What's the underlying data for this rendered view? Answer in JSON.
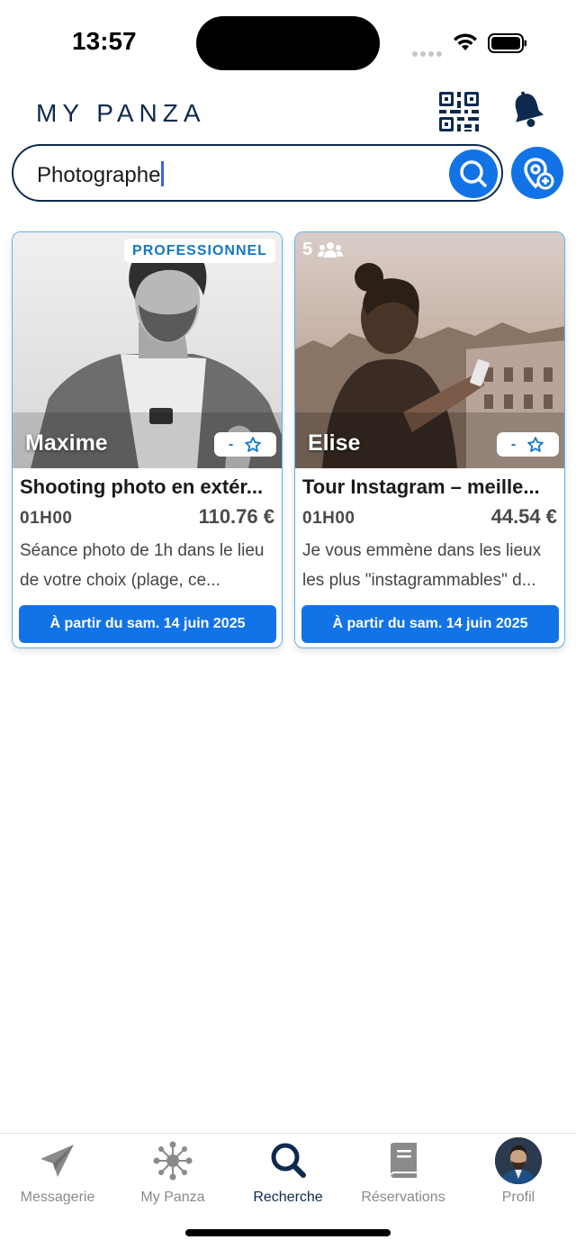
{
  "status": {
    "time": "13:57"
  },
  "header": {
    "brand": "MY PANZA",
    "qr_icon": "qr-code-icon",
    "bell_icon": "bell-icon"
  },
  "search": {
    "value": "Photographe",
    "search_icon": "search-icon",
    "location_icon": "location-add-icon"
  },
  "colors": {
    "primary": "#1273e6",
    "navy": "#0d2a4e",
    "card_border": "#5cb5ec",
    "badge_text": "#1578c2"
  },
  "cards": [
    {
      "badge": "PROFESSIONNEL",
      "host": "Maxime",
      "rating": "-",
      "title": "Shooting photo en extér...",
      "duration": "01H00",
      "price": "110.76 €",
      "description": "Séance photo de 1h dans le lieu de votre choix (plage, ce...",
      "date_button": "À partir du sam. 14 juin 2025"
    },
    {
      "group_count": "5",
      "host": "Elise",
      "rating": "-",
      "title": "Tour Instagram – meille...",
      "duration": "01H00",
      "price": "44.54 €",
      "description": "Je vous emmène dans les lieux les plus \"instagrammables\" d...",
      "date_button": "À partir du sam. 14 juin 2025"
    }
  ],
  "tabs": [
    {
      "label": "Messagerie",
      "icon": "paper-plane-icon"
    },
    {
      "label": "My Panza",
      "icon": "network-icon"
    },
    {
      "label": "Recherche",
      "icon": "search-icon",
      "active": true
    },
    {
      "label": "Réservations",
      "icon": "book-icon"
    },
    {
      "label": "Profil",
      "icon": "avatar"
    }
  ]
}
